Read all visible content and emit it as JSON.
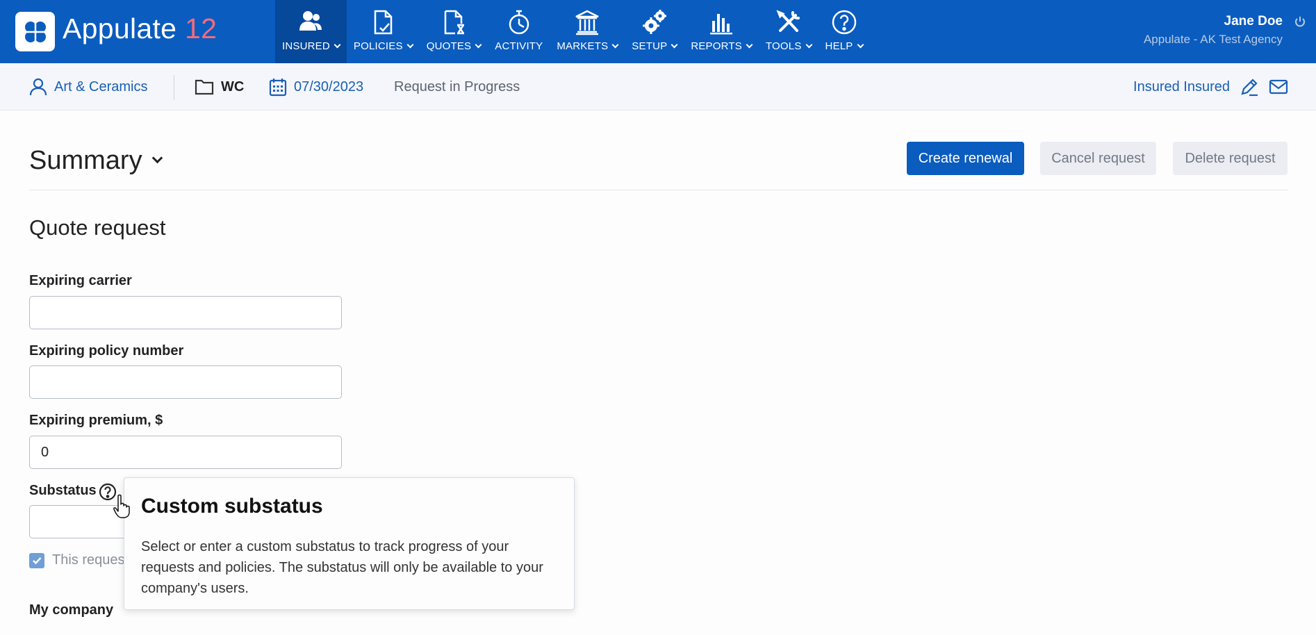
{
  "brand": {
    "name": "Appulate",
    "version": "12"
  },
  "nav": [
    {
      "label": "INSURED",
      "icon": "insured-icon",
      "active": true
    },
    {
      "label": "POLICIES",
      "icon": "policies-icon"
    },
    {
      "label": "QUOTES",
      "icon": "quotes-icon"
    },
    {
      "label": "ACTIVITY",
      "icon": "activity-icon"
    },
    {
      "label": "MARKETS",
      "icon": "markets-icon"
    },
    {
      "label": "SETUP",
      "icon": "setup-icon"
    },
    {
      "label": "REPORTS",
      "icon": "reports-icon"
    },
    {
      "label": "TOOLS",
      "icon": "tools-icon"
    },
    {
      "label": "HELP",
      "icon": "help-icon"
    }
  ],
  "user": {
    "name": "Jane Doe",
    "agency": "Appulate - AK Test Agency"
  },
  "context": {
    "insured": "Art & Ceramics",
    "lob": "WC",
    "date": "07/30/2023",
    "status": "Request in Progress",
    "contact": "Insured Insured"
  },
  "page": {
    "title": "Summary",
    "buttons": {
      "create": "Create renewal",
      "cancel": "Cancel request",
      "delete": "Delete request"
    },
    "section": "Quote request"
  },
  "form": {
    "expiring_carrier": {
      "label": "Expiring carrier",
      "value": ""
    },
    "expiring_policy": {
      "label": "Expiring policy number",
      "value": ""
    },
    "expiring_premium": {
      "label": "Expiring premium, $",
      "value": "0"
    },
    "substatus": {
      "label": "Substatus",
      "value": ""
    },
    "checkbox": {
      "label": "This reques",
      "checked": true
    },
    "my_company": "My company"
  },
  "tooltip": {
    "title": "Custom substatus",
    "body": "Select or enter a custom substatus to track progress of your requests and policies. The substatus will only be available to your company's users."
  },
  "colors": {
    "primary": "#0a5cbf",
    "link": "#1a5fb4",
    "version": "#f26a7e"
  }
}
